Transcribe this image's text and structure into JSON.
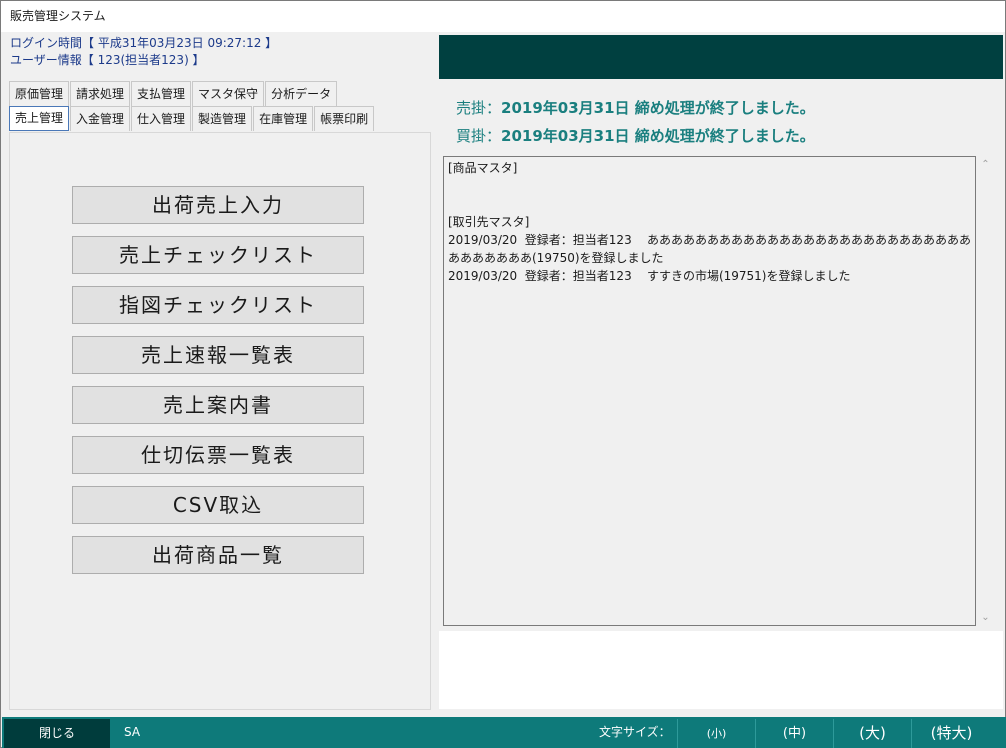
{
  "window": {
    "title": "販売管理システム"
  },
  "login": {
    "time_line": "ログイン時間【 平成31年03月23日 09:27:12 】",
    "user_line": "ユーザー情報【 123(担当者123) 】"
  },
  "tabs": {
    "row_top": [
      "原価管理",
      "請求処理",
      "支払管理",
      "マスタ保守",
      "分析データ"
    ],
    "row_bottom": [
      "売上管理",
      "入金管理",
      "仕入管理",
      "製造管理",
      "在庫管理",
      "帳票印刷"
    ],
    "active": "売上管理"
  },
  "menu": {
    "buttons": [
      "出荷売上入力",
      "売上チェックリスト",
      "指図チェックリスト",
      "売上速報一覧表",
      "売上案内書",
      "仕切伝票一覧表",
      "CSV取込",
      "出荷商品一覧"
    ]
  },
  "notices": {
    "sales_label": "売掛：",
    "sales_text": "2019年03月31日 締め処理が終了しました。",
    "purchase_label": "買掛：",
    "purchase_text": "2019年03月31日 締め処理が終了しました。"
  },
  "log": {
    "lines": [
      "[商品マスタ]",
      "",
      "",
      "[取引先マスタ]",
      "2019/03/20  登録者：担当者123    ああああああああああああああああああああああああああああああああああ(19750)を登録しました",
      "2019/03/20  登録者：担当者123    すすきの市場(19751)を登録しました"
    ]
  },
  "footer": {
    "close_label": "閉じる",
    "user_code": "SA",
    "font_size_label": "文字サイズ：",
    "size_small": "(小)",
    "size_medium": "(中)",
    "size_large": "(大)",
    "size_xlarge": "(特大)"
  },
  "colors": {
    "header_bar": "#004040",
    "footer_bar": "#0e7a7a",
    "notice_text": "#1a7f7f",
    "login_text": "#1c3a8a"
  }
}
